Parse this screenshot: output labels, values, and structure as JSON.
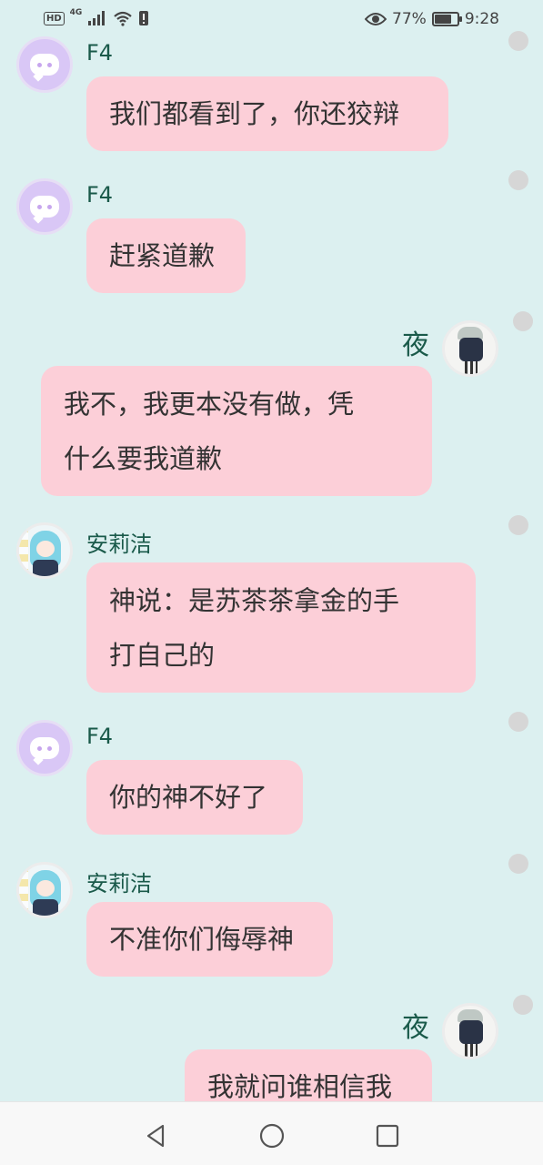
{
  "status_bar": {
    "network_badge": "HD",
    "signal_label": "4G",
    "battery_percent_text": "77%",
    "battery_level": 0.77,
    "time": "9:28",
    "icons": [
      "hd-icon",
      "signal-icon",
      "wifi-icon",
      "alert-icon",
      "eye-icon",
      "battery-icon"
    ]
  },
  "messages": [
    {
      "sender": "F4",
      "text": "我们都看到了，你还狡辩",
      "side": "left",
      "avatar": "chat-bot-avatar"
    },
    {
      "sender": "F4",
      "text": "赶紧道歉",
      "side": "left",
      "avatar": "chat-bot-avatar"
    },
    {
      "sender": "夜",
      "text_lines": [
        "我不，我更本没有做，凭",
        "什么要我道歉"
      ],
      "side": "right",
      "avatar": "gothic-girl-avatar"
    },
    {
      "sender": "安莉洁",
      "text_lines": [
        "神说：是苏茶茶拿金的手",
        "打自己的"
      ],
      "side": "left",
      "avatar": "blue-hair-girl-avatar"
    },
    {
      "sender": "F4",
      "text": "你的神不好了",
      "side": "left",
      "avatar": "chat-bot-avatar"
    },
    {
      "sender": "安莉洁",
      "text": "不准你们侮辱神",
      "side": "left",
      "avatar": "blue-hair-girl-avatar"
    },
    {
      "sender": "夜",
      "text": "我就问谁相信我",
      "side": "right",
      "avatar": "gothic-girl-avatar"
    }
  ],
  "nav_bar": {
    "icons": [
      "back-triangle-icon",
      "home-circle-icon",
      "recent-square-icon"
    ]
  },
  "colors": {
    "background": "#dcf0f0",
    "bubble": "#fccfd8",
    "name_text": "#1a5a4a",
    "bot_avatar": "#d9c7f6"
  }
}
